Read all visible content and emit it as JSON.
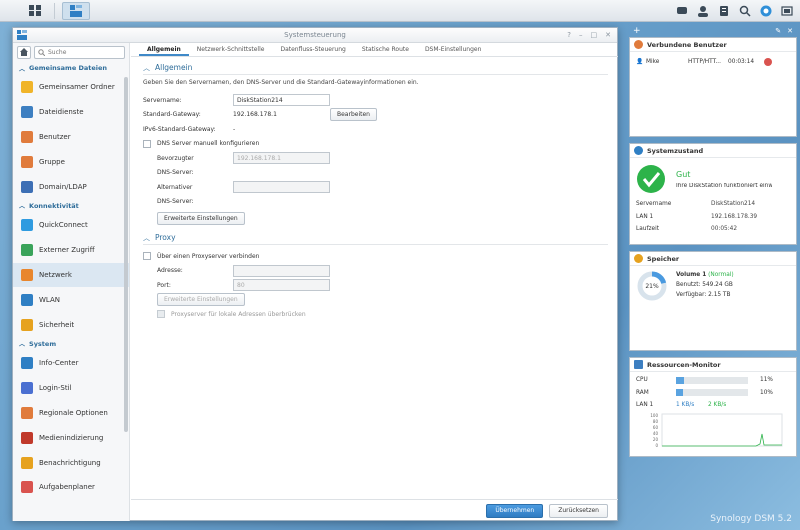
{
  "window": {
    "title": "Systemsteuerung"
  },
  "sidebar": {
    "search_placeholder": "Suche",
    "sections": [
      {
        "label": "Gemeinsame Dateien",
        "items": [
          {
            "label": "Gemeinsamer Ordner",
            "icon": "folder-icon",
            "color": "#f0b429"
          },
          {
            "label": "Dateidienste",
            "icon": "file-services-icon",
            "color": "#3d7fc1"
          },
          {
            "label": "Benutzer",
            "icon": "user-icon",
            "color": "#e07b3c"
          },
          {
            "label": "Gruppe",
            "icon": "group-icon",
            "color": "#e07b3c"
          },
          {
            "label": "Domain/LDAP",
            "icon": "domain-icon",
            "color": "#3d6fb5"
          }
        ]
      },
      {
        "label": "Konnektivität",
        "items": [
          {
            "label": "QuickConnect",
            "icon": "quickconnect-icon",
            "color": "#2f9be0"
          },
          {
            "label": "Externer Zugriff",
            "icon": "globe-icon",
            "color": "#3aa35a"
          },
          {
            "label": "Netzwerk",
            "icon": "network-icon",
            "color": "#e8862d",
            "active": true
          },
          {
            "label": "WLAN",
            "icon": "wifi-icon",
            "color": "#2f7fc4"
          },
          {
            "label": "Sicherheit",
            "icon": "shield-icon",
            "color": "#e6a21f"
          }
        ]
      },
      {
        "label": "System",
        "items": [
          {
            "label": "Info-Center",
            "icon": "info-icon",
            "color": "#2f7fc4"
          },
          {
            "label": "Login-Stil",
            "icon": "login-style-icon",
            "color": "#4a6fd1"
          },
          {
            "label": "Regionale Optionen",
            "icon": "clock-icon",
            "color": "#e07b3c"
          },
          {
            "label": "Medienindizierung",
            "icon": "media-icon",
            "color": "#c0392b"
          },
          {
            "label": "Benachrichtigung",
            "icon": "notification-icon",
            "color": "#e6a21f"
          },
          {
            "label": "Aufgabenplaner",
            "icon": "calendar-icon",
            "color": "#d9534f"
          }
        ]
      }
    ]
  },
  "tabs": [
    "Allgemein",
    "Netzwerk-Schnittstelle",
    "Datenfluss-Steuerung",
    "Statische Route",
    "DSM-Einstellungen"
  ],
  "general": {
    "title": "Allgemein",
    "description": "Geben Sie den Servernamen, den DNS-Server und die Standard-Gatewayinformationen ein.",
    "servername_label": "Servername:",
    "servername_value": "DiskStation214",
    "gateway_label": "Standard-Gateway:",
    "gateway_value": "192.168.178.1",
    "edit_button": "Bearbeiten",
    "ipv6_label": "IPv6-Standard-Gateway:",
    "ipv6_value": "-",
    "dns_manual_label": "DNS Server manuell konfigurieren",
    "preferred_dns_label_1": "Bevorzugter",
    "preferred_dns_label_2": "DNS-Server:",
    "preferred_dns_value": "192.168.178.1",
    "alt_dns_label_1": "Alternativer",
    "alt_dns_label_2": "DNS-Server:",
    "alt_dns_value": "",
    "advanced_button": "Erweiterte Einstellungen"
  },
  "proxy": {
    "title": "Proxy",
    "connect_label": "Über einen Proxyserver verbinden",
    "address_label": "Adresse:",
    "address_value": "",
    "port_label": "Port:",
    "port_value": "80",
    "advanced_button": "Erweiterte Einstellungen",
    "bypass_label": "Proxyserver für lokale Adressen überbrücken"
  },
  "footer": {
    "apply": "Übernehmen",
    "reset": "Zurücksetzen"
  },
  "widgets": {
    "users": {
      "title": "Verbundene Benutzer",
      "rows": [
        {
          "name": "Mike",
          "protocol": "HTTP/HTT...",
          "time": "00:03:14"
        }
      ]
    },
    "health": {
      "title": "Systemzustand",
      "status": "Gut",
      "message": "Ihre DiskStation funktioniert einwandfrei.",
      "rows": [
        {
          "k": "Servername",
          "v": "DiskStation214"
        },
        {
          "k": "LAN 1",
          "v": "192.168.178.39"
        },
        {
          "k": "Laufzeit",
          "v": "00:05:42"
        }
      ]
    },
    "storage": {
      "title": "Speicher",
      "percent_label": "21%",
      "percent": 21,
      "volume": "Volume 1",
      "volume_status": "(Normal)",
      "used": "Benutzt: 549.24 GB",
      "available": "Verfügbar: 2.15 TB"
    },
    "resources": {
      "title": "Ressourcen-Monitor",
      "cpu_label": "CPU",
      "cpu_value": "11%",
      "cpu_percent": 11,
      "ram_label": "RAM",
      "ram_value": "10%",
      "ram_percent": 10,
      "lan_label": "LAN 1",
      "up": "1 KB/s",
      "down": "2 KB/s",
      "y_ticks": [
        "100",
        "80",
        "60",
        "40",
        "20",
        "0"
      ]
    }
  },
  "branding": "Synology DSM 5.2",
  "colors": {
    "accent": "#3f89c8",
    "ok": "#2db34a",
    "link": "#2f6d9a"
  }
}
